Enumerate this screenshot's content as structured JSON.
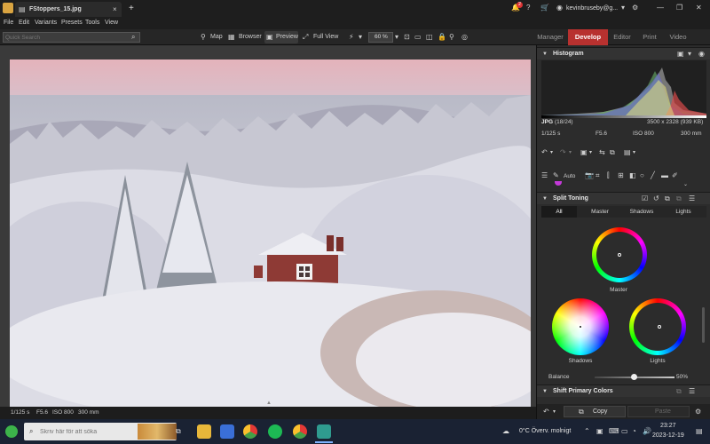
{
  "window": {
    "tab_title": "FStoppers_15.jpg",
    "new_tab": "+",
    "account": "kevinbruseby@g...",
    "notification_count": "2"
  },
  "menu": [
    "File",
    "Edit",
    "Variants",
    "Presets",
    "Tools",
    "View"
  ],
  "toolbar": {
    "search_placeholder": "Quick Search",
    "views": [
      "Map",
      "Browser",
      "Preview",
      "Full View"
    ],
    "zoom": "60 %",
    "modules": [
      "Manager",
      "Develop",
      "Editor",
      "Print",
      "Video"
    ]
  },
  "status": {
    "shutter": "1/125 s",
    "aperture": "F5.6",
    "iso": "ISO 800",
    "focal": "300 mm"
  },
  "panel": {
    "histogram_title": "Histogram",
    "file_format": "JPG",
    "file_index": "(18/24)",
    "dimensions": "3500 x 2328 (939 KB)",
    "shutter": "1/125 s",
    "aperture": "F5.6",
    "iso": "ISO 800",
    "focal": "300 mm",
    "auto_label": "Auto",
    "split_toning_title": "Split Toning",
    "tone_tabs": [
      "All",
      "Master",
      "Shadows",
      "Lights"
    ],
    "wheel_master": "Master",
    "wheel_shadows": "Shadows",
    "wheel_lights": "Lights",
    "balance_label": "Balance",
    "balance_value": "50%",
    "next_section_title": "Shift Primary Colors",
    "copy_label": "Copy",
    "paste_label": "Paste"
  },
  "taskbar": {
    "search_placeholder": "Skriv här för att söka",
    "weather": "0°C  Överv. molnigt",
    "time": "23:27",
    "date": "2023-12-19"
  },
  "colors": {
    "accent": "#b8312f",
    "panel_bg": "#2c2c2c",
    "taskbar_bg": "#1a2233"
  }
}
